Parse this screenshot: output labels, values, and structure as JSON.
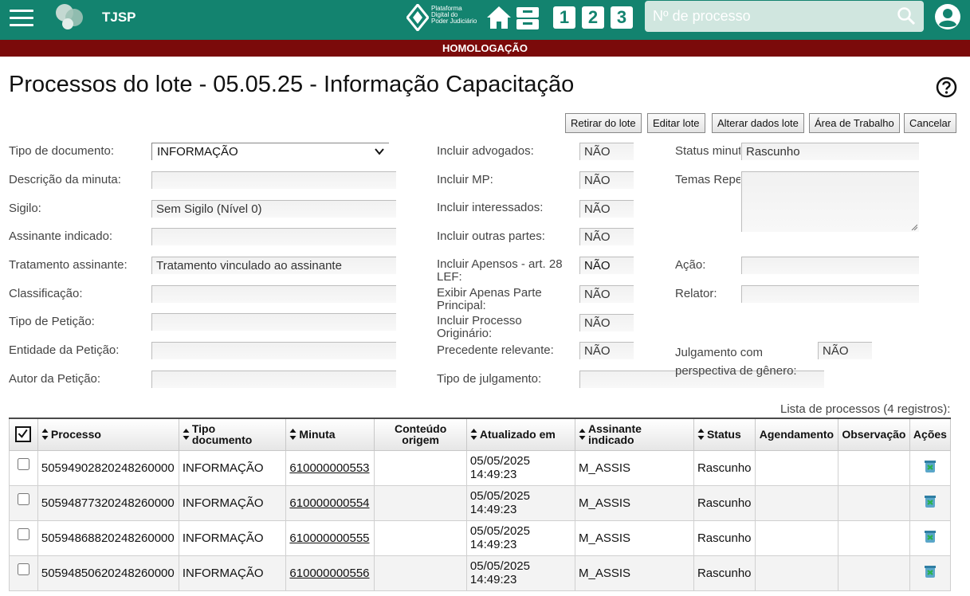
{
  "header": {
    "court": "TJSP",
    "pdpj_lines": [
      "Plataforma",
      "Digital do",
      "Poder Judiciário"
    ],
    "quick_buttons": [
      "1",
      "2",
      "3"
    ],
    "search_placeholder": "Nº de processo",
    "environment": "HOMOLOGAÇÃO"
  },
  "page": {
    "title": "Processos do lote - 05.05.25 - Informação Capacitação"
  },
  "actions": {
    "retirar": "Retirar do lote",
    "editar": "Editar lote",
    "alterar": "Alterar dados lote",
    "area": "Área de Trabalho",
    "cancelar": "Cancelar"
  },
  "form": {
    "tipo_documento": {
      "label": "Tipo de documento:",
      "value": "INFORMAÇÃO"
    },
    "descricao": {
      "label": "Descrição da minuta:",
      "value": ""
    },
    "sigilo": {
      "label": "Sigilo:",
      "value": "Sem Sigilo (Nível 0)"
    },
    "assinante": {
      "label": "Assinante indicado:",
      "value": ""
    },
    "tratamento": {
      "label": "Tratamento assinante:",
      "value": "Tratamento vinculado ao assinante"
    },
    "classificacao": {
      "label": "Classificação:",
      "value": ""
    },
    "tipo_peticao": {
      "label": "Tipo de Petição:",
      "value": ""
    },
    "entidade": {
      "label": "Entidade da Petição:",
      "value": ""
    },
    "autor": {
      "label": "Autor da Petição:",
      "value": ""
    },
    "incluir_advogados": {
      "label": "Incluir advogados:",
      "value": "NÃO"
    },
    "incluir_mp": {
      "label": "Incluir MP:",
      "value": "NÃO"
    },
    "incluir_interessados": {
      "label": "Incluir interessados:",
      "value": "NÃO"
    },
    "incluir_outras": {
      "label": "Incluir outras partes:",
      "value": "NÃO"
    },
    "incluir_apensos": {
      "label": "Incluir Apensos - art. 28 LEF:",
      "value": "NÃO"
    },
    "exibir_parte": {
      "label": "Exibir Apenas Parte Principal:",
      "value": "NÃO"
    },
    "incluir_originario": {
      "label": "Incluir Processo Originário:",
      "value": "NÃO"
    },
    "precedente": {
      "label": "Precedente relevante:",
      "value": "NÃO"
    },
    "tipo_julgamento": {
      "label": "Tipo de julgamento:",
      "value": ""
    },
    "status_minuta": {
      "label": "Status minut",
      "value": "Rascunho"
    },
    "temas": {
      "label": "Temas Repe",
      "value": ""
    },
    "acao": {
      "label": "Ação:",
      "value": ""
    },
    "relator": {
      "label": "Relator:",
      "value": ""
    },
    "julgamento_genero": {
      "label": "Julgamento com perspectiva de gênero:",
      "value": "NÃO"
    }
  },
  "list": {
    "count_text": "Lista de processos (4 registros):",
    "columns": {
      "processo": "Processo",
      "tipo": "Tipo documento",
      "minuta": "Minuta",
      "conteudo": "Conteúdo origem",
      "atualizado": "Atualizado em",
      "assinante": "Assinante indicado",
      "status": "Status",
      "agendamento": "Agendamento",
      "observacao": "Observação",
      "acoes": "Ações"
    },
    "rows": [
      {
        "processo": "50594902820248260000",
        "tipo": "INFORMAÇÃO",
        "minuta": "610000000553",
        "conteudo": "",
        "atualizado_data": "05/05/2025",
        "atualizado_hora": "14:49:23",
        "assinante": "M_ASSIS",
        "status": "Rascunho",
        "agendamento": "",
        "observacao": ""
      },
      {
        "processo": "50594877320248260000",
        "tipo": "INFORMAÇÃO",
        "minuta": "610000000554",
        "conteudo": "",
        "atualizado_data": "05/05/2025",
        "atualizado_hora": "14:49:23",
        "assinante": "M_ASSIS",
        "status": "Rascunho",
        "agendamento": "",
        "observacao": ""
      },
      {
        "processo": "50594868820248260000",
        "tipo": "INFORMAÇÃO",
        "minuta": "610000000555",
        "conteudo": "",
        "atualizado_data": "05/05/2025",
        "atualizado_hora": "14:49:23",
        "assinante": "M_ASSIS",
        "status": "Rascunho",
        "agendamento": "",
        "observacao": ""
      },
      {
        "processo": "50594850620248260000",
        "tipo": "INFORMAÇÃO",
        "minuta": "610000000556",
        "conteudo": "",
        "atualizado_data": "05/05/2025",
        "atualizado_hora": "14:49:23",
        "assinante": "M_ASSIS",
        "status": "Rascunho",
        "agendamento": "",
        "observacao": ""
      }
    ]
  },
  "colors": {
    "topbar": "#13836f",
    "environment_bar": "#7b0a0a",
    "search_bg": "#d0e6df"
  },
  "icons": [
    "menu-icon",
    "tjsp-logo",
    "pdpj-logo",
    "home-icon",
    "inbox-icon",
    "search-icon",
    "user-icon",
    "help-icon",
    "chevron-down-icon",
    "sort-icon",
    "trash-icon"
  ]
}
